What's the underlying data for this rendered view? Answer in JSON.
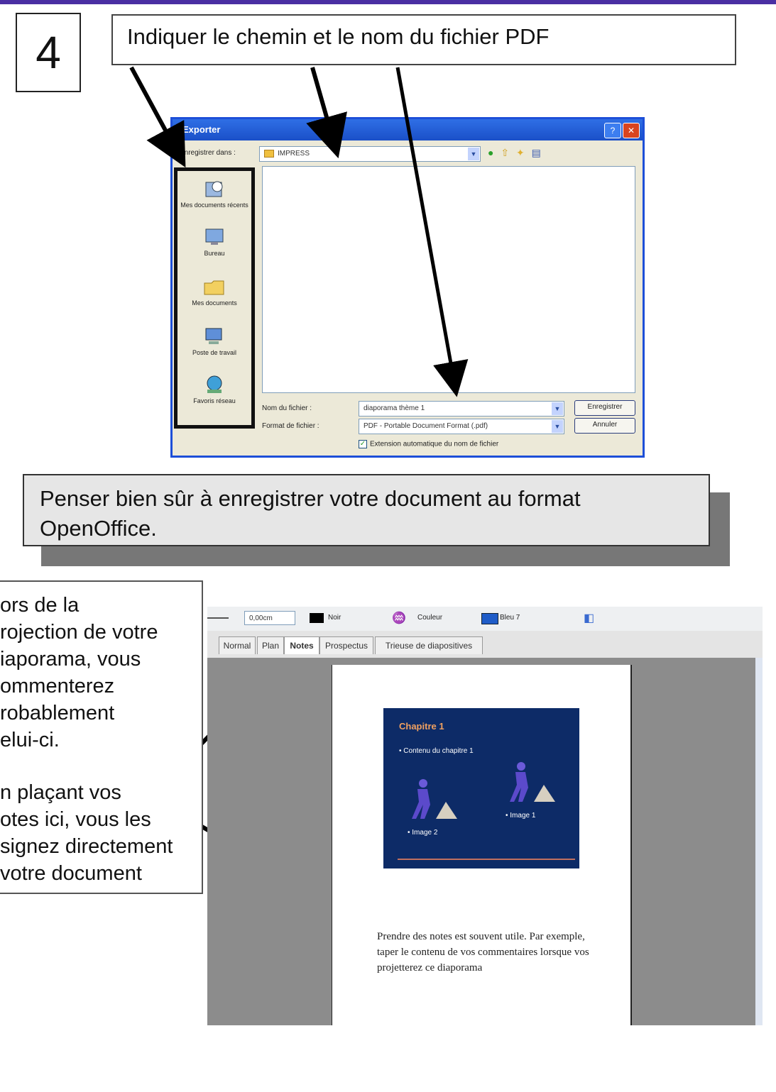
{
  "step": {
    "number": "4"
  },
  "title": "Indiquer le chemin et le nom du fichier PDF",
  "dialog": {
    "title": "Exporter",
    "save_in_label": "Enregistrer dans :",
    "folder": "IMPRESS",
    "places": [
      {
        "label": "Mes documents récents",
        "icon": "recent-documents-icon"
      },
      {
        "label": "Bureau",
        "icon": "desktop-icon"
      },
      {
        "label": "Mes documents",
        "icon": "my-documents-icon"
      },
      {
        "label": "Poste de travail",
        "icon": "my-computer-icon"
      },
      {
        "label": "Favoris réseau",
        "icon": "network-icon"
      }
    ],
    "filename_label": "Nom du fichier :",
    "filename_value": "diaporama thème 1",
    "format_label": "Format de fichier :",
    "format_value": "PDF - Portable Document Format (.pdf)",
    "save_button": "Enregistrer",
    "cancel_button": "Annuler",
    "auto_ext_label": "Extension automatique du nom de fichier",
    "auto_ext_checked": true
  },
  "note": "Penser bien sûr à enregistrer votre document au format OpenOffice.",
  "side_text": {
    "lines": [
      "ors de la",
      "rojection de votre",
      "iaporama,  vous",
      "ommenterez",
      "robablement",
      "elui-ci.",
      "",
      "n plaçant vos",
      "otes ici, vous les",
      "signez directement",
      " votre document"
    ]
  },
  "impress": {
    "toolbar": {
      "line_width": "0,00cm",
      "color_name": "Noir",
      "fill_type": "Couleur",
      "fill_color": "Bleu 7"
    },
    "tabs": [
      "Normal",
      "Plan",
      "Notes",
      "Prospectus",
      "Trieuse de diapositives"
    ],
    "active_tab": "Notes",
    "slide": {
      "title": "Chapitre 1",
      "bullet": "• Contenu du chapitre 1",
      "image_left": "• Image 2",
      "image_right": "• Image 1"
    },
    "notes": "Prendre des notes est souvent utile. Par exemple, taper le contenu de vos commentaires lorsque vos projetterez ce diaporama"
  },
  "colors": {
    "accent": "#4a2fa3",
    "xp_blue": "#1d4fd8",
    "slide_bg": "#0d2b67",
    "slide_title": "#f0a060"
  }
}
